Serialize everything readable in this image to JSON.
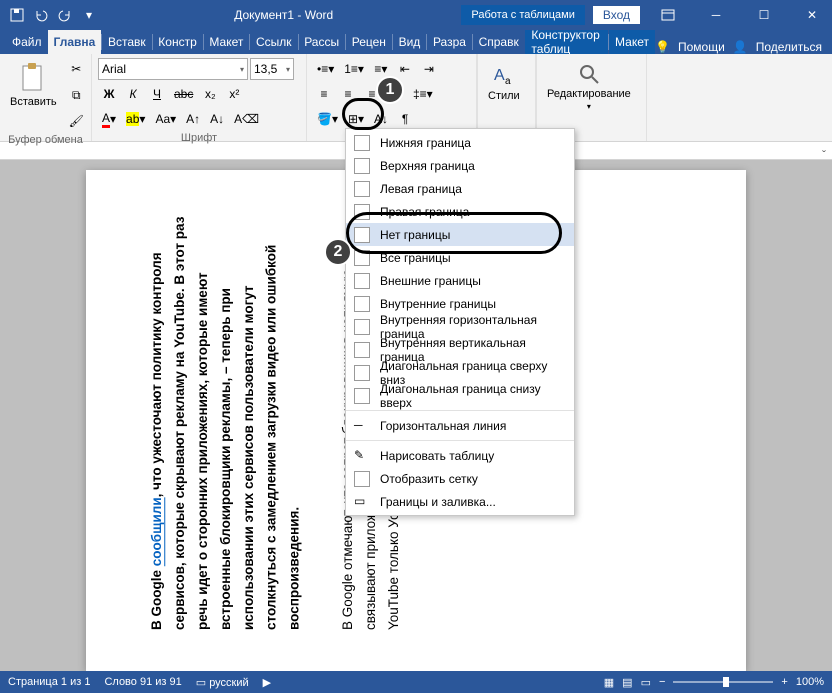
{
  "titlebar": {
    "document_title": "Документ1 - Word",
    "table_tools": "Работа с таблицами",
    "login": "Вход"
  },
  "tabs": {
    "file": "Файл",
    "home": "Главна",
    "insert": "Вставк",
    "design": "Констр",
    "layout": "Макет",
    "references": "Ссылк",
    "mailings": "Рассы",
    "review": "Рецен",
    "view": "Вид",
    "developer": "Разра",
    "help": "Справк",
    "table_design": "Конструктор таблиц",
    "table_layout": "Макет",
    "help_btn": "Помощи",
    "share": "Поделиться"
  },
  "ribbon": {
    "clipboard": {
      "label": "Буфер обмена",
      "paste": "Вставить"
    },
    "font": {
      "label": "Шрифт",
      "name": "Arial",
      "size": "13,5",
      "bold": "Ж",
      "italic": "К",
      "underline": "Ч",
      "strike": "abc",
      "sub": "x₂",
      "sup": "x²"
    },
    "styles": {
      "label": "Стили",
      "button": "Стили"
    },
    "editing": {
      "label": "Редактирование"
    }
  },
  "borders_menu": {
    "items": [
      "Нижняя граница",
      "Верхняя граница",
      "Левая граница",
      "Правая граница",
      "Нет границы",
      "Все границы",
      "Внешние границы",
      "Внутренние границы",
      "Внутренняя горизонтальная граница",
      "Внутренняя вертикальная граница",
      "Диагональная граница сверху вниз",
      "Диагональная граница снизу вверх",
      "Горизонтальная линия",
      "Нарисовать таблицу",
      "Отобразить сетку",
      "Границы и заливка..."
    ]
  },
  "doc": {
    "para1_pre": "В Google ",
    "para1_link": "сообщили",
    "para1_post": ", что ужесточают политику контроля сервисов, которые скрывают рекламу на YouTube. В этот раз речь идет о сторонних приложениях, которые имеют встроенные блокировщики рекламы, – теперь при использовании этих сервисов пользователи могут столкнуться с замедлением загрузки видео или ошибкой воспроизведения.",
    "para2": "В Google отмечают, что запрет блокировщиков напрямую связывают приложениям мо получает денеж если реклама скр YouTube только Условиям предо частности, не за"
  },
  "status": {
    "page": "Страница 1 из 1",
    "words": "Слово 91 из 91",
    "lang": "русский",
    "zoom": "100%"
  }
}
